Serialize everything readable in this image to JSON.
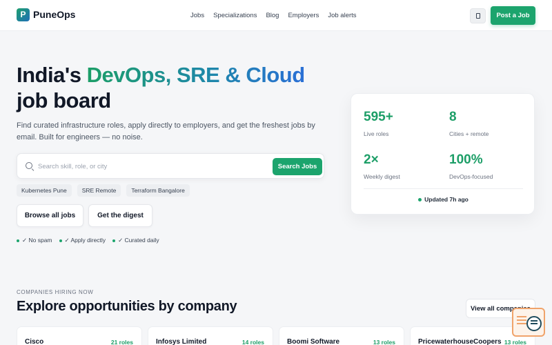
{
  "header": {
    "logo_letter": "P",
    "brand": "PuneOps",
    "nav": [
      "Jobs",
      "Specializations",
      "Blog",
      "Employers",
      "Job alerts"
    ],
    "post_job": "Post a Job"
  },
  "hero": {
    "title_part1": "India's ",
    "title_highlight": "DevOps, SRE & Cloud",
    "title_part2": "job board",
    "subtitle": "Find curated infrastructure roles, apply directly to employers, and get the freshest jobs by email. Built for engineers — no noise.",
    "search_placeholder": "Search skill, role, or city",
    "search_button": "Search Jobs",
    "chips": [
      "Kubernetes Pune",
      "SRE Remote",
      "Terraform Bangalore"
    ],
    "browse_button": "Browse all jobs",
    "digest_button": "Get the digest",
    "perks": [
      "✓ No spam",
      "✓ Apply directly",
      "✓ Curated daily"
    ]
  },
  "stats": {
    "items": [
      {
        "value": "595+",
        "label": "Live roles"
      },
      {
        "value": "8",
        "label": "Cities + remote"
      },
      {
        "value": "2×",
        "label": "Weekly digest"
      },
      {
        "value": "100%",
        "label": "DevOps-focused"
      }
    ],
    "updated": "Updated 7h ago"
  },
  "companies": {
    "kicker": "COMPANIES HIRING NOW",
    "title": "Explore opportunities by company",
    "view_all": "View all companies",
    "items": [
      {
        "name": "Cisco",
        "roles": "21 roles"
      },
      {
        "name": "Infosys Limited",
        "roles": "14 roles"
      },
      {
        "name": "Boomi Software",
        "roles": "13 roles"
      },
      {
        "name": "PricewaterhouseCoopers",
        "roles": "13 roles"
      }
    ]
  },
  "colors": {
    "accent": "#1ca46d",
    "gradient_start": "#1c9e67",
    "gradient_end": "#2a6fd6"
  }
}
